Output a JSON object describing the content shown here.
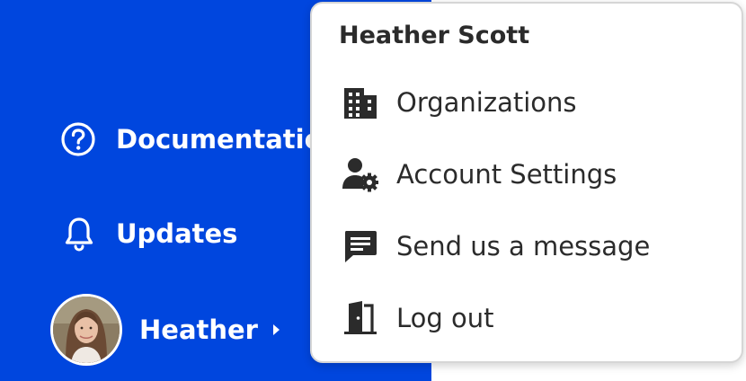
{
  "sidebar": {
    "background": "#0046de",
    "items": [
      {
        "label": "Documentation",
        "icon": "help-circle-icon"
      },
      {
        "label": "Updates",
        "icon": "bell-icon"
      }
    ],
    "user": {
      "name": "Heather",
      "icon": "chevron-right-icon"
    }
  },
  "menu": {
    "header": "Heather Scott",
    "items": [
      {
        "label": "Organizations",
        "icon": "building-icon"
      },
      {
        "label": "Account Settings",
        "icon": "user-gear-icon"
      },
      {
        "label": "Send us a message",
        "icon": "message-icon"
      },
      {
        "label": "Log out",
        "icon": "door-exit-icon"
      }
    ]
  }
}
